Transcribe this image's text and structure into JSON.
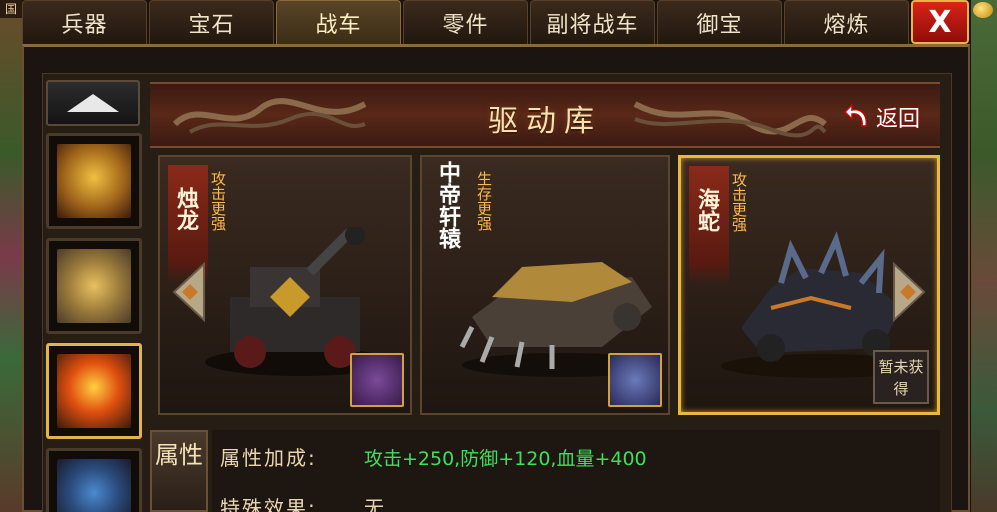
{
  "tabs": [
    "兵器",
    "宝石",
    "战车",
    "零件",
    "副将战车",
    "御宝",
    "熔炼"
  ],
  "active_tab_index": 2,
  "close_label": "X",
  "corner_label": "国",
  "title": "驱动库",
  "back_label": "返回",
  "cards": [
    {
      "name": "烛龙",
      "desc": "攻击更强",
      "selected": false
    },
    {
      "name": "中帝轩辕",
      "desc": "生存更强",
      "selected": false
    },
    {
      "name": "海蛇",
      "desc": "攻击更强",
      "selected": true,
      "status": "暂未获得"
    }
  ],
  "attributes": {
    "tag": "属性",
    "bonus_label": "属性加成:",
    "bonus_value": "攻击+250,防御+120,血量+400",
    "special_label": "特殊效果:",
    "special_value": "无"
  },
  "colors": {
    "accent": "#e8b840",
    "bonus": "#3ce05a",
    "close": "#d82418"
  }
}
